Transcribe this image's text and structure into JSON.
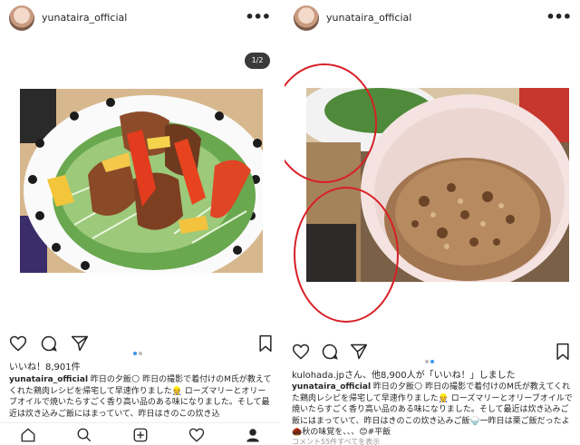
{
  "left_post": {
    "username": "yunataira_official",
    "more_icon": "more-dots-icon",
    "page_counter": "1/2",
    "likes": "いいね！8,901件",
    "caption_user": "yunataira_official",
    "caption_text": " 昨日の夕飯🌕 昨日の撮影で着付けのM氏が教えてくれた鶏肉レシピを帰宅して早速作りました👷 ローズマリーとオリーブオイルで焼いたらすごく香り高い品のある味になりました。そして最近は炊き込みご飯にはまっていて、昨日はきのこの炊き込",
    "carousel_active_index": 0
  },
  "right_post": {
    "username": "yunataira_official",
    "more_icon": "more-dots-icon",
    "likes": "kulohada.jpさん、他8,900人が「いいね！」しました",
    "caption_user": "yunataira_official",
    "caption_text": " 昨日の夕飯🌕 昨日の撮影で着付けのM氏が教えてくれた鶏肉レシピを帰宅して早速作りました👷 ローズマリーとオリーブオイルで焼いたらすごく香り高い品のある味になりました。そして最近は炊き込みご飯にはまっていて、昨日はきのこの炊き込みご飯🍚一昨日は栗ご飯だったよ🌰秋の味覚を、、、😊#平飯",
    "more_comments": "コメント55件すべてを表示",
    "carousel_active_index": 1
  },
  "accent_color": "#3897f0",
  "annotation_color": "#d81f26"
}
